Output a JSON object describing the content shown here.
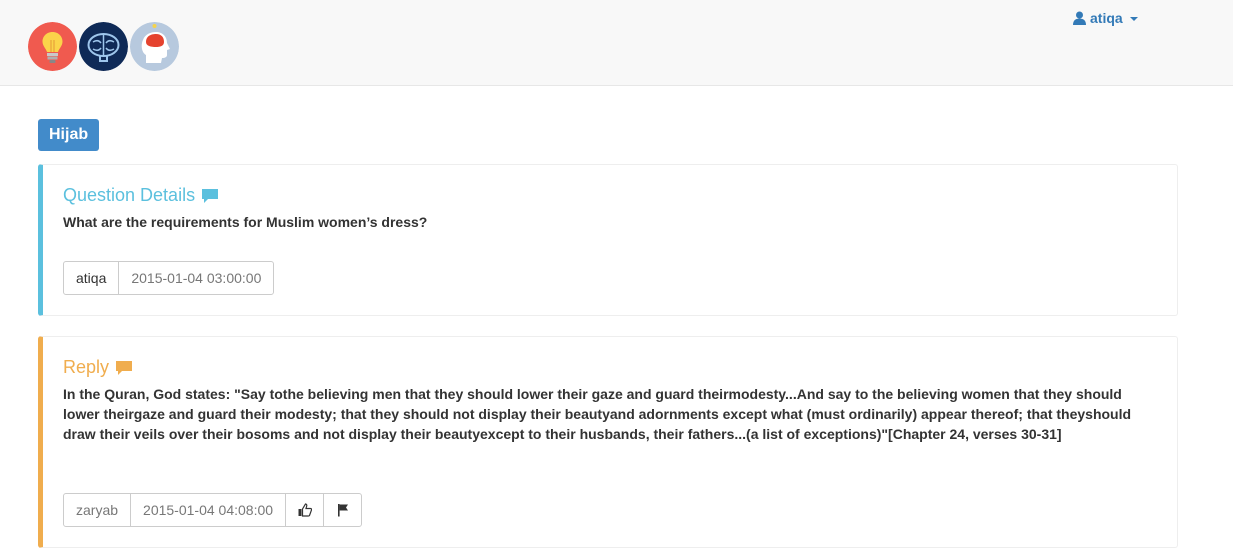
{
  "header": {
    "logos": [
      "lightbulb-logo",
      "brain-logo",
      "head-logo"
    ],
    "user": {
      "name": "atiqa",
      "icon": "user-icon"
    }
  },
  "category": {
    "label": "Hijab",
    "color": "#428bca"
  },
  "question": {
    "title": "Question Details",
    "text": "What are the requirements for Muslim women’s dress?",
    "author": "atiqa",
    "timestamp": "2015-01-04 03:00:00",
    "accent": "#5bc0de"
  },
  "reply": {
    "title": "Reply",
    "text": "In the Quran, God states: \"Say tothe believing men that they should lower their gaze and guard theirmodesty...And say to the believing women that they should lower theirgaze and guard their modesty; that they should not display their beautyand adornments except what (must ordinarily) appear thereof; that theyshould draw their veils over their bosoms and not display their beautyexcept to their husbands, their fathers...(a list of exceptions)\"[Chapter 24, verses 30-31]",
    "author": "zaryab",
    "timestamp": "2015-01-04 04:08:00",
    "actions": [
      "thumbs-up-icon",
      "flag-icon"
    ],
    "accent": "#f0ad4e"
  }
}
